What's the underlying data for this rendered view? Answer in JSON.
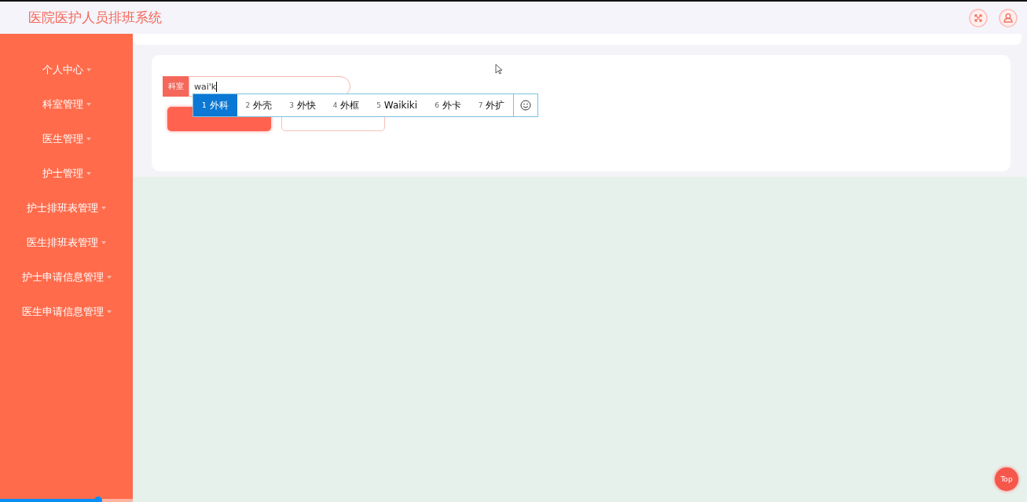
{
  "header": {
    "title": "医院医护人员排班系统"
  },
  "sidebar": {
    "items": [
      {
        "label": "个人中心"
      },
      {
        "label": "科室管理"
      },
      {
        "label": "医生管理"
      },
      {
        "label": "护士管理"
      },
      {
        "label": "护士排班表管理"
      },
      {
        "label": "医生排班表管理"
      },
      {
        "label": "护士申请信息管理"
      },
      {
        "label": "医生申请信息管理"
      }
    ]
  },
  "form": {
    "field": {
      "label": "科室",
      "value": "wai'k"
    },
    "buttons": [
      {
        "kind": "primary"
      },
      {
        "kind": "secondary"
      }
    ]
  },
  "ime": {
    "candidates": [
      {
        "number": "1",
        "text": "外科",
        "selected": true
      },
      {
        "number": "2",
        "text": "外壳",
        "selected": false
      },
      {
        "number": "3",
        "text": "外快",
        "selected": false
      },
      {
        "number": "4",
        "text": "外框",
        "selected": false
      },
      {
        "number": "5",
        "text": "Waikiki",
        "selected": false
      },
      {
        "number": "6",
        "text": "外卡",
        "selected": false
      },
      {
        "number": "7",
        "text": "外扩",
        "selected": false
      }
    ]
  },
  "top_button": {
    "label": "Top"
  }
}
